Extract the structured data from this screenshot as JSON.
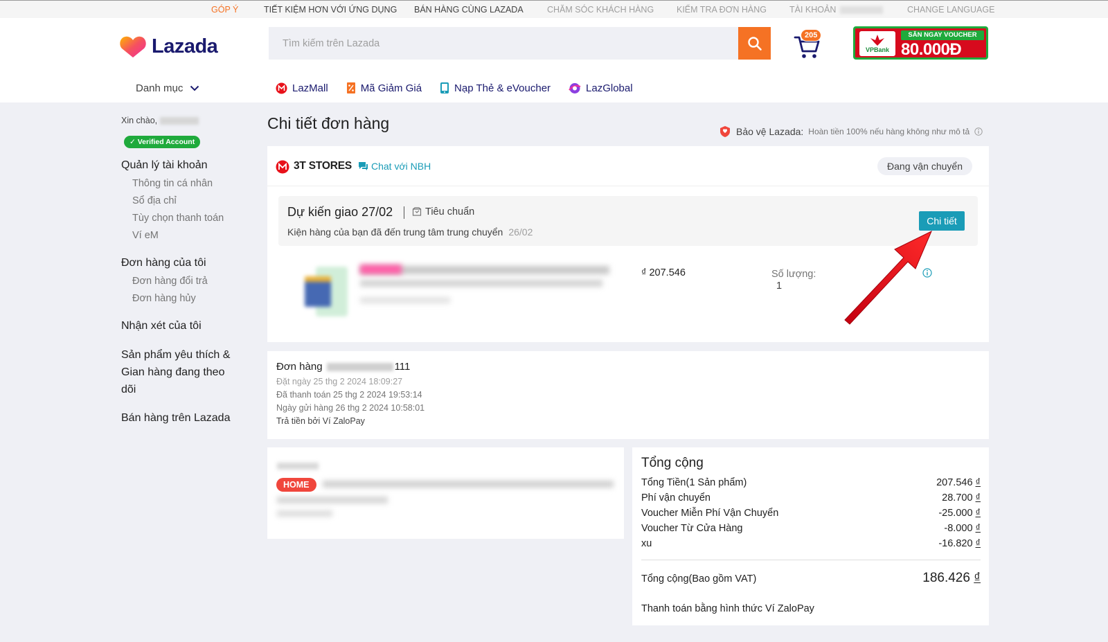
{
  "topbar": {
    "feedback": "GÓP Ý",
    "save_app": "TIẾT KIỆM HƠN VỚI ỨNG DỤNG",
    "sell": "BÁN HÀNG CÙNG LAZADA",
    "care": "CHĂM SÓC KHÁCH HÀNG",
    "track": "KIỂM TRA ĐƠN HÀNG",
    "account": "TÀI KHOẢN",
    "language": "CHANGE LANGUAGE"
  },
  "header": {
    "logo": "Lazada",
    "search_placeholder": "Tìm kiếm trên Lazada",
    "cart_count": "205",
    "voucher_top": "SĂN NGAY VOUCHER",
    "voucher_amount": "80.000Đ",
    "voucher_bank": "VPBank",
    "categories": "Danh mục",
    "nav": [
      "LazMall",
      "Mã Giảm Giá",
      "Nạp Thẻ & eVoucher",
      "LazGlobal"
    ]
  },
  "sidebar": {
    "hello": "Xin chào,",
    "verified": "Verified Account",
    "account_title": "Quản lý tài khoản",
    "account_items": [
      "Thông tin cá nhân",
      "Sổ địa chỉ",
      "Tùy chọn thanh toán",
      "Ví eM"
    ],
    "orders_title": "Đơn hàng của tôi",
    "orders_items": [
      "Đơn hàng đổi trả",
      "Đơn hàng hủy"
    ],
    "reviews": "Nhận xét của tôi",
    "wishlist_1": "Sản phẩm yêu thích &",
    "wishlist_2": "Gian hàng đang theo",
    "wishlist_3": "dõi",
    "sell": "Bán hàng trên Lazada"
  },
  "main": {
    "title": "Chi tiết đơn hàng",
    "protect_label": "Bảo vệ Lazada:",
    "protect_desc": "Hoàn tiền 100% nếu hàng không như mô tả",
    "store": "3T STORES",
    "chat": "Chat với NBH",
    "status": "Đang vận chuyển",
    "delivery_title": "Dự kiến giao 27/02",
    "delivery_type": "Tiêu chuẩn",
    "delivery_msg": "Kiện hàng của bạn đã đến trung tâm trung chuyển",
    "delivery_date": "26/02",
    "detail_btn": "Chi tiết",
    "price": "₫ 207.546",
    "qty_label": "Số lượng:",
    "qty_value": "1"
  },
  "order": {
    "label": "Đơn hàng",
    "id_suffix": "111",
    "placed": "Đặt ngày 25 thg 2 2024 18:09:27",
    "paid": "Đã thanh toán 25 thg 2 2024 19:53:14",
    "shipped": "Ngày gửi hàng 26 thg 2 2024 10:58:01",
    "paid_by": "Trả tiền bởi Ví ZaloPay"
  },
  "address": {
    "badge": "HOME"
  },
  "summary": {
    "title": "Tổng cộng",
    "rows": [
      {
        "label": "Tổng Tiền(1 Sản phẩm)",
        "value": "207.546",
        "cur": "₫"
      },
      {
        "label": "Phí vận chuyển",
        "value": "28.700",
        "cur": "₫"
      },
      {
        "label": "Voucher Miễn Phí Vận Chuyển",
        "value": "-25.000",
        "cur": "₫"
      },
      {
        "label": "Voucher Từ Cửa Hàng",
        "value": "-8.000",
        "cur": "₫"
      },
      {
        "label": "xu",
        "value": "-16.820",
        "cur": "₫"
      }
    ],
    "total_label": "Tổng cộng(Bao gồm VAT)",
    "total_value": "186.426",
    "total_cur": "₫",
    "payment": "Thanh toán bằng hình thức Ví ZaloPay"
  },
  "colors": {
    "accent": "#f57224",
    "teal": "#1a9cb7",
    "navy": "#1a1a6e",
    "green": "#1faa3c",
    "red_arrow": "#e8121b"
  }
}
